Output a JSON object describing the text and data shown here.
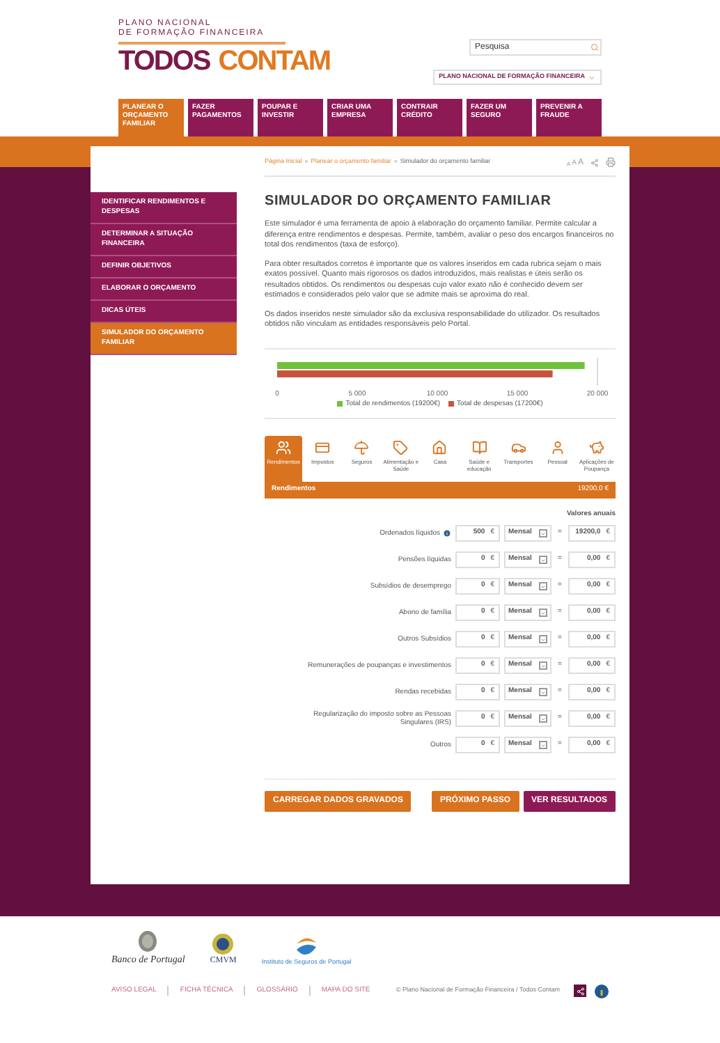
{
  "header": {
    "site_title": [
      "PLANO NACIONAL",
      "DE FORMAÇÃO FINANCEIRA"
    ],
    "logo": [
      "TODOS",
      "CONTAM"
    ],
    "search": {
      "placeholder": "Pesquisa"
    },
    "site_select": "PLANO NACIONAL DE FORMAÇÃO FINANCEIRA"
  },
  "nav_tabs": [
    {
      "label": "PLANEAR O ORÇAMENTO FAMILIAR",
      "selected": true
    },
    {
      "label": "FAZER PAGAMENTOS",
      "selected": false
    },
    {
      "label": "POUPAR E INVESTIR",
      "selected": false
    },
    {
      "label": "CRIAR UMA EMPRESA",
      "selected": false
    },
    {
      "label": "CONTRAIR CRÉDITO",
      "selected": false
    },
    {
      "label": "FAZER UM SEGURO",
      "selected": false
    },
    {
      "label": "PREVENIR A FRAUDE",
      "selected": false
    }
  ],
  "sidebar": {
    "items": [
      {
        "label": "IDENTIFICAR RENDIMENTOS E DESPESAS",
        "selected": false
      },
      {
        "label": "DETERMINAR A SITUAÇÃO FINANCEIRA",
        "selected": false
      },
      {
        "label": "DEFINIR OBJETIVOS",
        "selected": false
      },
      {
        "label": "ELABORAR O ORÇAMENTO",
        "selected": false
      },
      {
        "label": "DICAS ÚTEIS",
        "selected": false
      },
      {
        "label": "SIMULADOR DO ORÇAMENTO FAMILIAR",
        "selected": true
      }
    ]
  },
  "breadcrumb": [
    "Página Inicial",
    "Planear o orçamento familiar",
    "Simulador do orçamento familiar"
  ],
  "breadcrumb_separators": [
    "»",
    "»"
  ],
  "font_sizes": [
    "A",
    "A",
    "A"
  ],
  "title": "SIMULADOR DO ORÇAMENTO FAMILIAR",
  "paragraphs": [
    "Este simulador é uma ferramenta de apoio à elaboração do orçamento familiar. Permite calcular a diferença entre rendimentos e despesas. Permite, também, avaliar o peso dos encargos financeiros no total dos rendimentos (taxa de esforço).",
    "Para obter resultados corretos é importante que os valores inseridos em cada rubrica sejam o mais exatos possível. Quanto mais rigorosos os dados introduzidos, mais realistas e úteis serão os resultados obtidos. Os rendimentos ou despesas cujo valor exato não é conhecido devem ser estimados e considerados pelo valor que se admite mais se aproxima do real.",
    "Os dados inseridos neste simulador são da exclusiva responsabilidade do utilizador. Os resultados obtidos não vinculam as entidades responsáveis pelo Portal."
  ],
  "chart_data": {
    "type": "bar",
    "orientation": "horizontal",
    "legend": "bottom",
    "series": [
      {
        "name": "Total de rendimentos (19200€)",
        "color": "#72c13d",
        "values": [
          19200
        ]
      },
      {
        "name": "Total de despesas (17200€)",
        "color": "#c9523f",
        "values": [
          17200
        ]
      }
    ],
    "xlim": [
      0,
      20000
    ],
    "xticks": [
      {
        "value": 0,
        "label": "0"
      },
      {
        "value": 5000,
        "label": "5 000"
      },
      {
        "value": 10000,
        "label": "10 000"
      },
      {
        "value": 15000,
        "label": "15 000"
      },
      {
        "value": 20000,
        "label": "20 000"
      }
    ]
  },
  "category_tabs": [
    {
      "label": "Rendimentos",
      "selected": true
    },
    {
      "label": "Impostos",
      "selected": false
    },
    {
      "label": "Seguros",
      "selected": false
    },
    {
      "label": "Alimentação e Saúde",
      "selected": false
    },
    {
      "label": "Casa",
      "selected": false
    },
    {
      "label": "Saúde e educação",
      "selected": false
    },
    {
      "label": "Transportes",
      "selected": false
    },
    {
      "label": "Pessoal",
      "selected": false
    },
    {
      "label": "Aplicações de Poupança",
      "selected": false
    }
  ],
  "section": {
    "title": "Rendimentos",
    "total": "19200,0 €"
  },
  "annual_header": "Valores anuais",
  "rows": [
    {
      "label": "Ordenados líquidos",
      "info": true,
      "value": "500",
      "unit": "€",
      "frequency": "Mensal",
      "equals": "=",
      "result": "19200,0",
      "result_unit": "€"
    },
    {
      "label": "Pensões líquidas",
      "info": false,
      "value": "0",
      "unit": "€",
      "frequency": "Mensal",
      "equals": "=",
      "result": "0,00",
      "result_unit": "€"
    },
    {
      "label": "Subsídios de desemprego",
      "info": false,
      "value": "0",
      "unit": "€",
      "frequency": "Mensal",
      "equals": "=",
      "result": "0,00",
      "result_unit": "€"
    },
    {
      "label": "Abono de família",
      "info": false,
      "value": "0",
      "unit": "€",
      "frequency": "Mensal",
      "equals": "=",
      "result": "0,00",
      "result_unit": "€"
    },
    {
      "label": "Outros Subsídios",
      "info": false,
      "value": "0",
      "unit": "€",
      "frequency": "Mensal",
      "equals": "=",
      "result": "0,00",
      "result_unit": "€"
    },
    {
      "label": "Remunerações de poupanças e investimentos",
      "info": false,
      "value": "0",
      "unit": "€",
      "frequency": "Mensal",
      "equals": "=",
      "result": "0,00",
      "result_unit": "€"
    },
    {
      "label": "Rendas recebidas",
      "info": false,
      "value": "0",
      "unit": "€",
      "frequency": "Mensal",
      "equals": "=",
      "result": "0,00",
      "result_unit": "€"
    },
    {
      "label": "Regularização do imposto sobre as Pessoas Singulares (IRS)",
      "info": false,
      "value": "0",
      "unit": "€",
      "frequency": "Mensal",
      "equals": "=",
      "result": "0,00",
      "result_unit": "€"
    },
    {
      "label": "Outros",
      "info": false,
      "value": "0",
      "unit": "€",
      "frequency": "Mensal",
      "equals": "=",
      "result": "0,00",
      "result_unit": "€"
    }
  ],
  "buttons": [
    {
      "label": "CARREGAR DADOS GRAVADOS",
      "kind": "secondary"
    },
    {
      "label": "PRÓXIMO PASSO",
      "kind": "secondary"
    },
    {
      "label": "VER RESULTADOS",
      "kind": "primary"
    }
  ],
  "footer": {
    "partners": [
      "Banco de Portugal",
      "CMVM",
      "Instituto de Seguros de Portugal"
    ],
    "links": [
      "AVISO LEGAL",
      "FICHA TÉCNICA",
      "GLOSSÁRIO",
      "MAPA DO SITE"
    ],
    "copyright": "© Plano Nacional de Formação Financeira / Todos Contam"
  }
}
